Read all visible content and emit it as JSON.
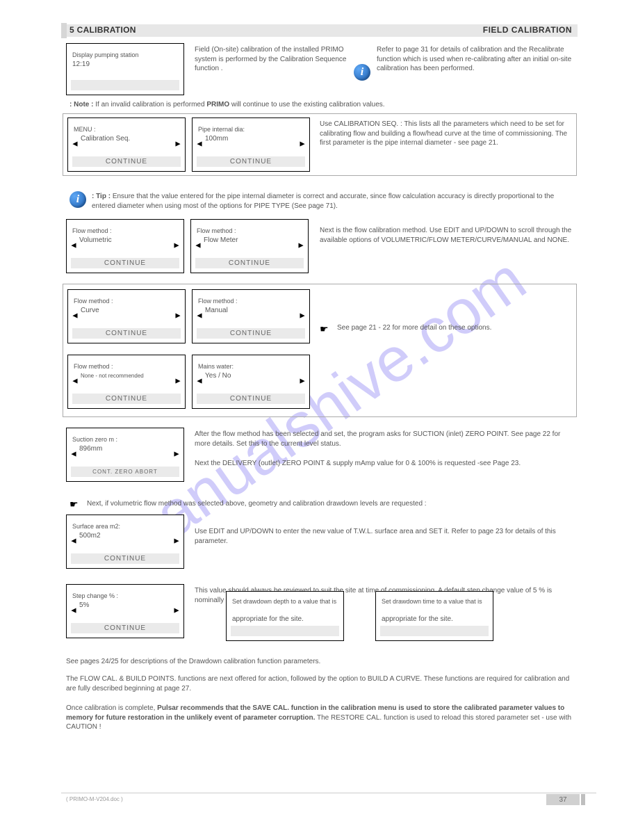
{
  "section": {
    "title": "5     CALIBRATION",
    "backtext": "FIELD CALIBRATION"
  },
  "intro": {
    "box_top": "Display pumping station",
    "box_time": "12:19",
    "box_bar": "",
    "p1": "Field (On-site) calibration of the installed PRIMO system is performed by the Calibration Sequence function .",
    "p2": "Refer to page 31 for details of calibration and the Recalibrate function which is used when re-calibrating after an initial on-site calibration has been performed.",
    "note_label": ": Note :",
    "note_text_1": "If an invalid calibration is performed ",
    "note_text_2": "PRIMO ",
    "note_text_3": "will continue to use the existing calibration values."
  },
  "row1": {
    "left_top": "MENU :",
    "left_mid": "Calibration Seq.",
    "left_bar": "CONTINUE",
    "right_top": "Pipe internal dia:",
    "right_mid": "100mm",
    "right_bar": "CONTINUE",
    "desc": "Use CALIBRATION SEQ.  :  This lists all the parameters which need to be set for calibrating flow and building a flow/head curve at the time of commissioning. The first parameter is the pipe internal diameter - see page 21."
  },
  "tip1": {
    "label": ": Tip :",
    "text": "Ensure that the value entered for the pipe internal diameter is correct and accurate, since flow calculation accuracy is directly proportional to the entered diameter when using most of the options for PIPE TYPE (See page 71)."
  },
  "row2": {
    "left_top": "Flow method :",
    "left_mid": "Volumetric",
    "left_bar": "CONTINUE",
    "right_top": "Flow method :",
    "right_mid": "Flow Meter",
    "right_bar": "CONTINUE",
    "desc": "Next is the flow calibration method. Use EDIT and UP/DOWN to scroll through the available options of VOLUMETRIC/FLOW METER/CURVE/MANUAL and NONE."
  },
  "row3": {
    "a_top": "Flow method :",
    "a_mid": "Curve",
    "a_bar": "CONTINUE",
    "b_top": "Flow method :",
    "b_mid": "Manual",
    "b_bar": "CONTINUE",
    "c_top": "Flow method :",
    "c_mid": "None  -  not recommended",
    "c_bar": "CONTINUE",
    "d_top": "Mains water:",
    "d_mid": "Yes / No",
    "d_bar": "CONTINUE",
    "note": "See page 21 - 22 for more detail on these options."
  },
  "row4": {
    "top": "Suction zero m :",
    "mid": "896mm",
    "bar": "CONT.  ZERO  ABORT",
    "desc": "After the flow method has been selected and set, the program asks for SUCTION (inlet) ZERO POINT. See page 22 for more details. Set this to the current level status.",
    "desc2": "Next the DELIVERY (outlet) ZERO POINT & supply mAmp value for 0 & 100% is requested -see Page 23."
  },
  "hand_note": "Next, if volumetric flow method was selected above, geometry and calibration drawdown levels are requested :",
  "row5": {
    "top": "Surface area m2:",
    "mid": "500m2",
    "bar": "CONTINUE",
    "desc": "Use EDIT and UP/DOWN to enter the new value of T.W.L. surface area and SET it. Refer to page 23 for details of this parameter."
  },
  "row6": {
    "left_top": "Step change % :",
    "left_mid": "5%",
    "left_bar": "CONTINUE",
    "mid_top": "Set drawdown depth to a value that is",
    "mid_mid": "appropriate for the site.",
    "mid_bar": "",
    "right_top": "Set drawdown time to a value that is",
    "right_mid": "appropriate for the site.",
    "right_bar": "",
    "desc": "This value should always be reviewed to suit the site at time of commissioning. A default step change value of 5 % is nominally suitable."
  },
  "bottom": {
    "p1": "See pages 24/25 for descriptions of the Drawdown calibration function parameters.",
    "p2": "The FLOW CAL. & BUILD POINTS. functions are next offered for action, followed by the option to BUILD A CURVE. These functions are required for calibration and are fully described beginning at page 27.",
    "p3_a": "Once calibration is complete, ",
    "p3_b": "Pulsar recommends that the SAVE CAL. function in the calibration menu is used to store the calibrated parameter values to memory for future restoration in the unlikely event of parameter corruption.",
    "p3_c": " The RESTORE CAL. function is used to reload this stored parameter set - use with CAUTION !"
  },
  "footer": {
    "text": "( PRIMO-M-V204.doc )",
    "page": "37"
  },
  "watermark": "manualshive.com"
}
